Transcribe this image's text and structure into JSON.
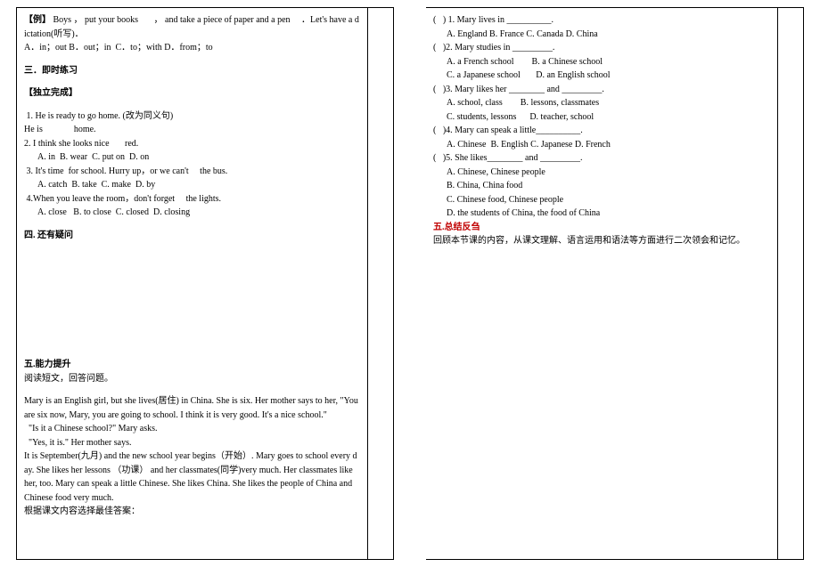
{
  "left": {
    "example_label": "【例】",
    "example_text": " Boys ， put your books       ， and take a piece of paper and a pen     ．Let's have a dictation(听写)．",
    "example_options": "A．in；out B．out；in  C．to；with D．from；to",
    "sec3_title": "三．即时练习",
    "sec3_sub": "【独立完成】",
    "q1_line1": " 1. He is ready to go home. (改为同义句)",
    "q1_line2": "He is              home.",
    "q2_line1": "2. I think she looks nice       red.",
    "q2_opts": "A. in  B. wear  C. put on  D. on",
    "q3_line1": " 3. It's time  for school. Hurry up，or we can't     the bus.",
    "q3_opts": "A. catch  B. take  C. make  D. by",
    "q4_line1": " 4.When you leave the room，don't forget     the lights.",
    "q4_opts": "A. close   B. to close  C. closed  D. closing",
    "sec4_title": "四. 还有疑问",
    "sec5_title": "五.能力提升",
    "sec5_sub": "阅读短文，回答问题。",
    "passage_p1": "Mary is an English girl, but she lives(居住) in China. She is six. Her mother says to her, \"You are six now, Mary, you are going to school. I think it is very good. It's a nice school.\"",
    "passage_p2": "  \"Is it a Chinese school?\" Mary asks.",
    "passage_p3": "  \"Yes, it is.\" Her mother says.",
    "passage_p4": "It is September(九月) and the new school year begins（开始）. Mary goes to school every day. She likes her lessons （功课） and her classmates(同学)very much. Her classmates like her, too. Mary can speak a little Chinese. She likes China. She likes the people of China and Chinese food very much.",
    "passage_instruction": "根据课文内容选择最佳答案："
  },
  "right": {
    "q1": "(   ) 1. Mary lives in __________.",
    "q1_opts": "A. England B. France C. Canada D. China",
    "q2": "(   )2. Mary studies in _________.",
    "q2_optA": "A. a French school        B. a Chinese school",
    "q2_optC": "C. a Japanese school       D. an English school",
    "q3": "(   )3. Mary likes her ________ and _________.",
    "q3_optA": "A. school, class        B. lessons, classmates",
    "q3_optC": "C. students, lessons      D. teacher, school",
    "q4": "(   )4. Mary can speak a little__________.",
    "q4_opts": "A. Chinese  B. English C. Japanese D. French",
    "q5": "(   )5. She likes________ and _________.",
    "q5_optA": "A. Chinese, Chinese people",
    "q5_optB": "B. China, China food",
    "q5_optC": "C. Chinese food, Chinese people",
    "q5_optD": "D. the students of China, the food of China",
    "sec_summary_title": "五.总结反刍",
    "sec_summary_text": "回顾本节课的内容，从课文理解、语言运用和语法等方面进行二次领会和记忆。"
  }
}
